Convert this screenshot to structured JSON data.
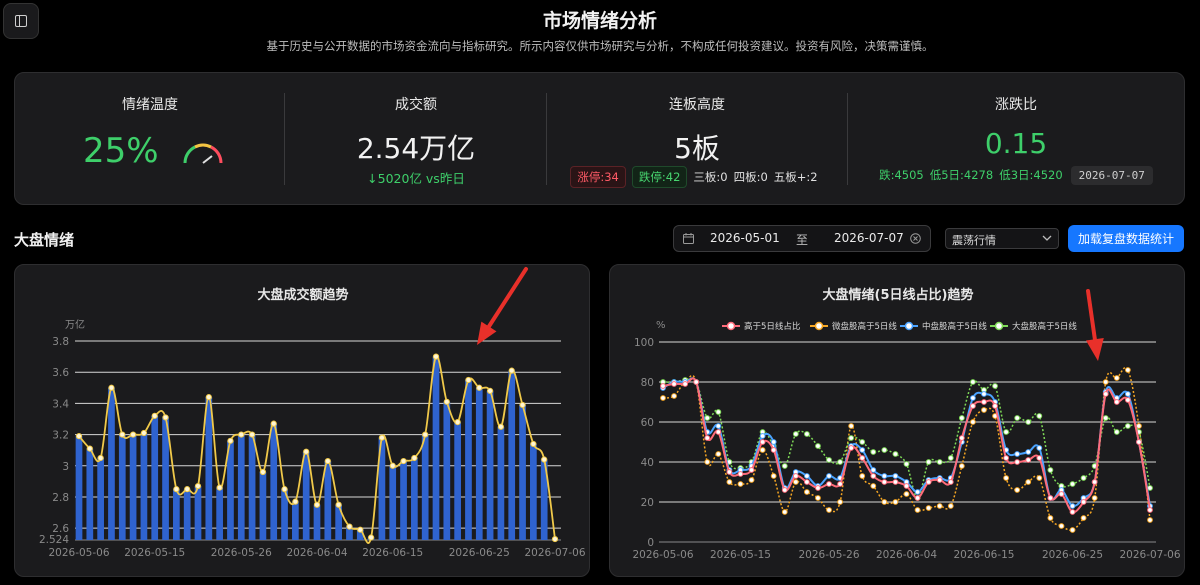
{
  "header": {
    "title": "市场情绪分析",
    "subtitle": "基于历史与公开数据的市场资金流向与指标研究。所示内容仅供市场研究与分析，不构成任何投资建议。投资有风险，决策需谨慎。"
  },
  "metrics": {
    "temperature": {
      "label": "情绪温度",
      "value": "25%",
      "level": 0.25
    },
    "turnover": {
      "label": "成交额",
      "value": "2.54万亿",
      "delta": "↓5020亿 vs昨日"
    },
    "board_height": {
      "label": "连板高度",
      "value": "5板",
      "limit_up": "涨停:34",
      "limit_down": "跌停:42",
      "board2": "三板:0",
      "board4": "四板:0",
      "board5": "五板+:2"
    },
    "adv_dec": {
      "label": "涨跌比",
      "value": "0.15",
      "down": "跌:4505",
      "low5": "低5日:4278",
      "low3": "低3日:4520",
      "date": "2026-07-07"
    }
  },
  "section": {
    "title": "大盘情绪"
  },
  "filters": {
    "start_date": "2026-05-01",
    "separator": "至",
    "end_date": "2026-07-07",
    "market_mode": "震荡行情",
    "load_button": "加载复盘数据统计"
  },
  "colors": {
    "green": "#3ecf6a",
    "red": "#ff4d5e",
    "accent": "#1677ff",
    "bar_fill": "#2f63cf",
    "bar_line": "#f0c94a",
    "s_red": "#ff6b7a",
    "s_orange": "#f5a623",
    "s_blue": "#4aa3ff",
    "s_green": "#7ed957"
  },
  "chart_data": [
    {
      "type": "bar",
      "title": "大盘成交额趋势",
      "unit": "万亿",
      "ylim": [
        2.524,
        3.8
      ],
      "yticks": [
        2.6,
        2.8,
        3,
        3.2,
        3.4,
        3.6,
        3.8
      ],
      "ymin_label": "2.524",
      "xtick_labels": [
        "2026-05-06",
        "2026-05-15",
        "2026-05-26",
        "2026-06-04",
        "2026-06-15",
        "2026-06-25",
        "2026-07-06"
      ],
      "values": [
        3.19,
        3.11,
        3.05,
        3.5,
        3.2,
        3.2,
        3.21,
        3.32,
        3.31,
        2.85,
        2.85,
        2.87,
        3.44,
        2.86,
        3.16,
        3.2,
        3.2,
        2.96,
        3.27,
        2.85,
        2.77,
        3.09,
        2.75,
        3.03,
        2.75,
        2.61,
        2.59,
        2.54,
        3.18,
        3.0,
        3.03,
        3.05,
        3.2,
        3.7,
        3.41,
        3.28,
        3.55,
        3.5,
        3.48,
        3.25,
        3.61,
        3.39,
        3.14,
        3.04,
        2.53
      ]
    },
    {
      "type": "line",
      "title": "大盘情绪(5日线占比)趋势",
      "unit": "%",
      "ylim": [
        0,
        100
      ],
      "yticks": [
        0,
        20,
        40,
        60,
        80,
        100
      ],
      "legend_position": "top",
      "xtick_labels": [
        "2026-05-06",
        "2026-05-15",
        "2026-05-26",
        "2026-06-04",
        "2026-06-15",
        "2026-06-25",
        "2026-07-06"
      ],
      "series": [
        {
          "name": "高于5日线占比",
          "color": "#ff6b7a",
          "values": [
            78,
            79,
            79,
            80,
            52,
            55,
            35,
            34,
            36,
            50,
            46,
            26,
            33,
            30,
            27,
            29,
            29,
            47,
            42,
            33,
            30,
            30,
            28,
            22,
            30,
            31,
            30,
            52,
            68,
            70,
            68,
            42,
            40,
            41,
            42,
            22,
            24,
            15,
            20,
            30,
            74,
            70,
            71,
            50,
            16
          ]
        },
        {
          "name": "微盘股高于5日线",
          "color": "#f5a623",
          "values": [
            72,
            73,
            80,
            80,
            40,
            44,
            30,
            29,
            31,
            46,
            33,
            15,
            30,
            25,
            22,
            16,
            20,
            58,
            33,
            28,
            20,
            20,
            24,
            16,
            17,
            18,
            18,
            38,
            60,
            66,
            63,
            32,
            26,
            30,
            32,
            12,
            8,
            6,
            12,
            22,
            80,
            82,
            86,
            58,
            11
          ]
        },
        {
          "name": "中盘股高于5日线",
          "color": "#4aa3ff",
          "values": [
            77,
            80,
            80,
            80,
            55,
            58,
            36,
            36,
            38,
            53,
            50,
            27,
            35,
            33,
            28,
            33,
            32,
            48,
            46,
            36,
            33,
            33,
            30,
            25,
            31,
            32,
            32,
            50,
            72,
            74,
            70,
            46,
            44,
            45,
            47,
            22,
            26,
            18,
            22,
            30,
            75,
            72,
            74,
            50,
            18
          ]
        },
        {
          "name": "大盘股高于5日线",
          "color": "#7ed957",
          "values": [
            80,
            80,
            81,
            80,
            62,
            65,
            40,
            37,
            40,
            55,
            48,
            38,
            54,
            54,
            48,
            41,
            40,
            52,
            50,
            45,
            46,
            44,
            39,
            22,
            40,
            40,
            42,
            62,
            80,
            76,
            78,
            55,
            62,
            60,
            63,
            36,
            28,
            29,
            32,
            38,
            62,
            55,
            58,
            55,
            27
          ]
        }
      ]
    }
  ]
}
